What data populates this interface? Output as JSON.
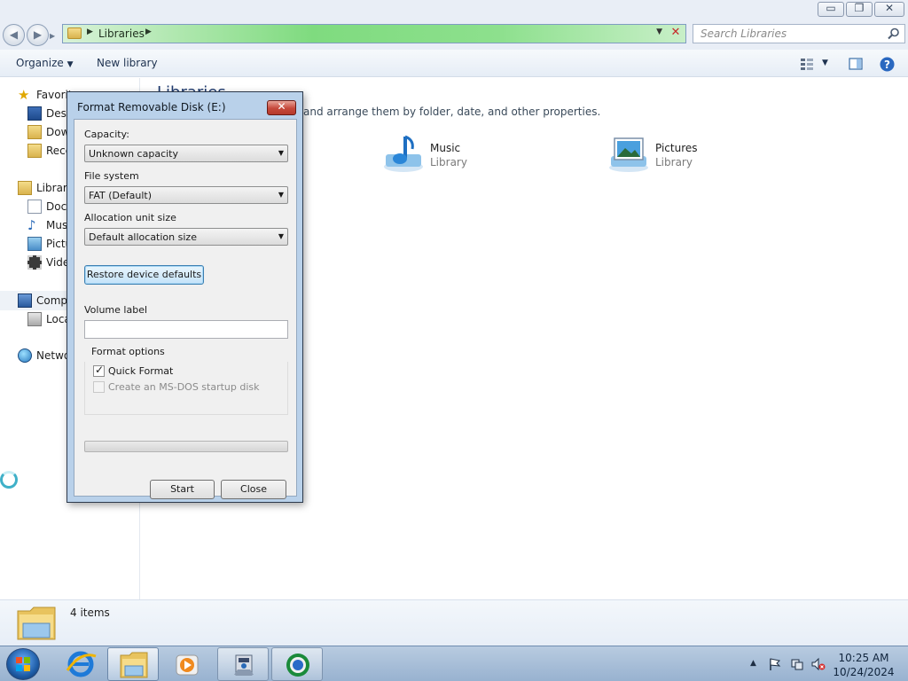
{
  "explorer": {
    "window_controls": {
      "minimize": "▭",
      "maximize": "❐",
      "close": "✕"
    },
    "address": {
      "path_label": "Libraries"
    },
    "search": {
      "placeholder": "Search Libraries"
    },
    "toolbar": {
      "organize_label": "Organize",
      "new_library_label": "New library"
    },
    "navpane": {
      "favorites": "Favorit",
      "favorites_items": [
        "Desk",
        "Dow",
        "Rece"
      ],
      "libraries": "Librari",
      "libraries_items": [
        "Docu",
        "Mus",
        "Pictu",
        "Vide"
      ],
      "computer": "Comp",
      "computer_items": [
        "Loca"
      ],
      "network": "Netwo"
    },
    "content": {
      "title": "Libraries",
      "subtitle": "and arrange them by folder, date, and other properties.",
      "libraries": [
        {
          "name": "Music",
          "type": "Library"
        },
        {
          "name": "Pictures",
          "type": "Library"
        }
      ]
    },
    "status": {
      "items_count": "4 items"
    }
  },
  "dialog": {
    "title": "Format Removable Disk (E:)",
    "close_glyph": "✕",
    "capacity_label": "Capacity:",
    "capacity_value": "Unknown capacity",
    "filesystem_label": "File system",
    "filesystem_value": "FAT (Default)",
    "allocation_label": "Allocation unit size",
    "allocation_value": "Default allocation size",
    "restore_label": "Restore device defaults",
    "volume_label": "Volume label",
    "volume_value": "",
    "format_options_label": "Format options",
    "quick_format_label": "Quick Format",
    "quick_format_checked": true,
    "msdos_label": "Create an MS-DOS startup disk",
    "msdos_checked": false,
    "progress_fraction": 0,
    "start_label": "Start",
    "close_label": "Close"
  },
  "taskbar": {
    "pinned": [
      "start-orb",
      "internet-explorer-icon",
      "windows-explorer-icon",
      "media-player-icon",
      "network-utility-icon",
      "browser-icon"
    ],
    "clock_time": "10:25 AM",
    "clock_date": "10/24/2024",
    "tray_overflow": "▲"
  },
  "colors": {
    "address_progress": "#7fdb7f",
    "dialog_frame": "#b9d1ea",
    "taskbar": "#98b2d0"
  }
}
